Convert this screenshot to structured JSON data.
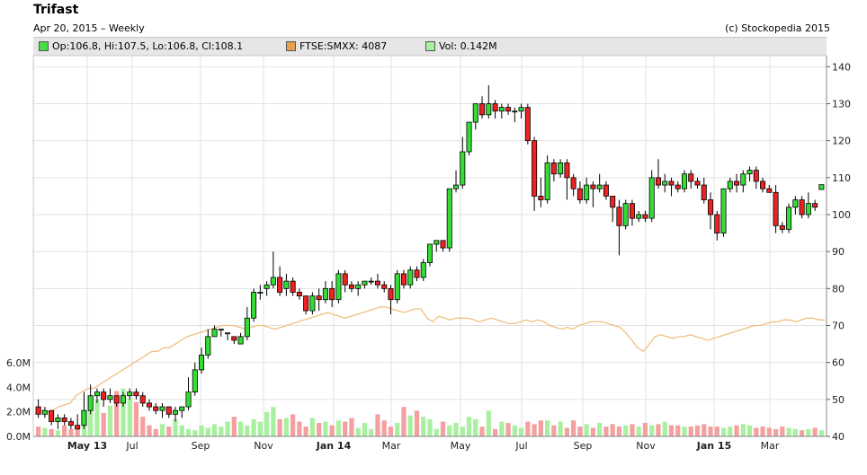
{
  "header": {
    "title": "Trifast",
    "subtitle": "Apr 20, 2015 – Weekly",
    "credit": "(c) Stockopedia 2015"
  },
  "legend": [
    {
      "label": "Op:106.8, Hi:107.5, Lo:106.8, Cl:108.1",
      "color": "#44dd44"
    },
    {
      "label": "FTSE:SMXX: 4087",
      "color": "#e8a050"
    },
    {
      "label": "Vol: 0.142M",
      "color": "#a8f0a0"
    }
  ],
  "chart_data": {
    "type": "candlestick",
    "x_tick_labels": [
      "May 13",
      "Jul",
      "Sep",
      "Nov",
      "Jan 14",
      "Mar",
      "May",
      "Jul",
      "Sep",
      "Nov",
      "Jan 15",
      "Mar"
    ],
    "bold_tick_labels": [
      "May 13",
      "Jan 14",
      "Jan 15"
    ],
    "price_ticks": [
      40,
      50,
      60,
      70,
      80,
      90,
      100,
      110,
      120,
      130,
      140
    ],
    "volume_ticks": [
      "0.0M",
      "2.0M",
      "4.0M",
      "6.0M"
    ],
    "price_range": [
      40,
      143
    ],
    "grid": true,
    "colors": {
      "up": "#33dd33",
      "down": "#ee2222",
      "vol_up": "#a8f0a0",
      "vol_down": "#f4a0a0",
      "index_line": "#f0c080"
    },
    "series": [
      {
        "name": "Trifast",
        "ohlc": [
          [
            48,
            50,
            45,
            46
          ],
          [
            46,
            48,
            45,
            47
          ],
          [
            47,
            47,
            43,
            44
          ],
          [
            44,
            46,
            42,
            45
          ],
          [
            45,
            46,
            43,
            44
          ],
          [
            44,
            45,
            42,
            43
          ],
          [
            43,
            46,
            42,
            42
          ],
          [
            43,
            52,
            42,
            47
          ],
          [
            47,
            54,
            46,
            51
          ],
          [
            51,
            53,
            49,
            52
          ],
          [
            52,
            53,
            48,
            50
          ],
          [
            50,
            53,
            49,
            51
          ],
          [
            51,
            51,
            48,
            49
          ],
          [
            49,
            52,
            48,
            51
          ],
          [
            51,
            53,
            50,
            52
          ],
          [
            52,
            53,
            50,
            51
          ],
          [
            51,
            52,
            48,
            49
          ],
          [
            49,
            50,
            47,
            48
          ],
          [
            48,
            49,
            46,
            47
          ],
          [
            47,
            49,
            45,
            48
          ],
          [
            48,
            48,
            45,
            46
          ],
          [
            46,
            48,
            44,
            47
          ],
          [
            47,
            48,
            45,
            48
          ],
          [
            48,
            56,
            47,
            52
          ],
          [
            52,
            60,
            51,
            58
          ],
          [
            58,
            64,
            57,
            62
          ],
          [
            62,
            69,
            61,
            67
          ],
          [
            67,
            70,
            67,
            69
          ],
          [
            69,
            69,
            67,
            69
          ],
          [
            68,
            68,
            66,
            68
          ],
          [
            67,
            67,
            65,
            66
          ],
          [
            65,
            68,
            65,
            67
          ],
          [
            67,
            75,
            66,
            72
          ],
          [
            72,
            80,
            71,
            79
          ],
          [
            79,
            81,
            77,
            79
          ],
          [
            80,
            82,
            78,
            81
          ],
          [
            81,
            90,
            80,
            83
          ],
          [
            83,
            86,
            78,
            79
          ],
          [
            80,
            84,
            78,
            82
          ],
          [
            82,
            83,
            78,
            79
          ],
          [
            79,
            80,
            77,
            78
          ],
          [
            78,
            78,
            73,
            74
          ],
          [
            74,
            79,
            73,
            78
          ],
          [
            78,
            80,
            74,
            77
          ],
          [
            77,
            82,
            76,
            80
          ],
          [
            80,
            82,
            75,
            77
          ],
          [
            77,
            85,
            76,
            84
          ],
          [
            84,
            85,
            79,
            81
          ],
          [
            81,
            82,
            79,
            80
          ],
          [
            80,
            82,
            78,
            81
          ],
          [
            81,
            82,
            80,
            82
          ],
          [
            82,
            83,
            81,
            82
          ],
          [
            82,
            84,
            80,
            81
          ],
          [
            81,
            82,
            79,
            80
          ],
          [
            80,
            81,
            73,
            77
          ],
          [
            77,
            85,
            76,
            84
          ],
          [
            84,
            85,
            80,
            81
          ],
          [
            81,
            86,
            80,
            85
          ],
          [
            85,
            86,
            82,
            83
          ],
          [
            83,
            88,
            82,
            87
          ],
          [
            87,
            91,
            86,
            92
          ],
          [
            92,
            93,
            90,
            93
          ],
          [
            93,
            93,
            90,
            91
          ],
          [
            91,
            101,
            90,
            107
          ],
          [
            107,
            112,
            106,
            108
          ],
          [
            108,
            121,
            107,
            117
          ],
          [
            117,
            122,
            116,
            125
          ],
          [
            125,
            130,
            123,
            130
          ],
          [
            130,
            132,
            126,
            127
          ],
          [
            127,
            135,
            126,
            130
          ],
          [
            130,
            131,
            126,
            128
          ],
          [
            128,
            130,
            126,
            129
          ],
          [
            129,
            130,
            127,
            128
          ],
          [
            128,
            129,
            125,
            128
          ],
          [
            128,
            130,
            126,
            129
          ],
          [
            129,
            130,
            119,
            120
          ],
          [
            120,
            121,
            101,
            105
          ],
          [
            105,
            110,
            102,
            104
          ],
          [
            104,
            116,
            103,
            114
          ],
          [
            114,
            115,
            109,
            111
          ],
          [
            111,
            115,
            110,
            114
          ],
          [
            114,
            115,
            104,
            110
          ],
          [
            110,
            111,
            105,
            107
          ],
          [
            107,
            109,
            103,
            104
          ],
          [
            104,
            110,
            103,
            108
          ],
          [
            108,
            109,
            102,
            107
          ],
          [
            107,
            111,
            106,
            108
          ],
          [
            108,
            109,
            104,
            105
          ],
          [
            105,
            105,
            98,
            102
          ],
          [
            102,
            104,
            89,
            97
          ],
          [
            97,
            104,
            96,
            103
          ],
          [
            103,
            104,
            97,
            99
          ],
          [
            99,
            101,
            98,
            100
          ],
          [
            100,
            101,
            98,
            99
          ],
          [
            99,
            112,
            98,
            110
          ],
          [
            110,
            115,
            107,
            108
          ],
          [
            108,
            111,
            106,
            109
          ],
          [
            109,
            110,
            105,
            108
          ],
          [
            108,
            109,
            106,
            107
          ],
          [
            107,
            112,
            106,
            111
          ],
          [
            111,
            112,
            107,
            109
          ],
          [
            109,
            110,
            107,
            108
          ],
          [
            108,
            110,
            103,
            104
          ],
          [
            104,
            106,
            96,
            100
          ],
          [
            100,
            101,
            93,
            95
          ],
          [
            95,
            107,
            94,
            107
          ],
          [
            107,
            110,
            106,
            109
          ],
          [
            109,
            111,
            106,
            108
          ],
          [
            108,
            112,
            106,
            111
          ],
          [
            111,
            113,
            109,
            112
          ],
          [
            112,
            113,
            107,
            109
          ],
          [
            109,
            110,
            106,
            107
          ],
          [
            107,
            108,
            106,
            106
          ],
          [
            106,
            108,
            95,
            97
          ],
          [
            97,
            98,
            95,
            96
          ],
          [
            96,
            103,
            95,
            102
          ],
          [
            102,
            105,
            100,
            104
          ],
          [
            104,
            105,
            99,
            100
          ],
          [
            100,
            106,
            99,
            103
          ],
          [
            103,
            104,
            101,
            102
          ],
          [
            106.8,
            107.5,
            106.8,
            108.1
          ]
        ]
      },
      {
        "name": "FTSE:SMXX",
        "values": [
          46,
          47,
          46.5,
          47,
          48,
          48.5,
          49,
          51,
          52,
          53,
          53,
          54,
          55,
          56,
          57,
          58,
          59,
          60,
          61,
          62,
          63,
          63,
          64,
          64,
          65,
          66,
          67,
          67.5,
          68,
          68.5,
          69,
          69.5,
          70,
          70,
          70,
          69.5,
          69,
          69.5,
          70,
          70,
          69.5,
          69,
          69.5,
          70,
          70.5,
          71,
          71.5,
          72,
          72.5,
          73,
          73.5,
          73,
          72.5,
          72,
          72.5,
          73,
          73.5,
          74,
          74.5,
          75,
          75,
          74.5,
          74,
          73.5,
          74,
          74.5,
          74.5,
          72,
          71,
          72.5,
          72,
          71.5,
          72,
          72,
          72,
          71.5,
          71,
          71.5,
          72,
          71.5,
          71,
          70.5,
          70.5,
          71,
          71.5,
          71,
          71.5,
          71,
          70,
          69.5,
          69,
          69.5,
          69,
          70,
          70.5,
          71,
          71,
          71,
          70.5,
          70,
          69.5,
          68,
          66,
          64,
          63,
          65,
          67,
          67.5,
          67,
          66.5,
          67,
          67,
          67.5,
          67,
          66.5,
          66,
          66.5,
          67,
          67.5,
          68,
          68.5,
          69,
          69.5,
          70,
          70,
          70.5,
          71,
          71,
          71.5,
          71.5,
          71,
          71.5,
          72,
          72,
          71.5,
          71.5
        ]
      },
      {
        "name": "Vol",
        "values": [
          0.8,
          0.7,
          0.6,
          0.5,
          0.9,
          0.6,
          0.7,
          1.1,
          2.2,
          3.0,
          1.9,
          2.5,
          3.7,
          3.9,
          3.1,
          2.8,
          1.6,
          0.9,
          0.6,
          1.0,
          0.8,
          1.4,
          0.9,
          0.6,
          0.5,
          0.9,
          0.7,
          1.0,
          0.8,
          1.2,
          1.6,
          1.2,
          0.9,
          1.4,
          1.2,
          2.0,
          2.4,
          1.4,
          1.5,
          1.8,
          1.2,
          0.8,
          1.5,
          1.1,
          1.2,
          0.9,
          1.3,
          1.2,
          1.5,
          0.7,
          1.1,
          0.6,
          1.8,
          1.3,
          0.8,
          1.1,
          2.4,
          1.7,
          2.1,
          1.6,
          1.4,
          0.6,
          1.2,
          0.9,
          1.1,
          0.8,
          1.6,
          1.4,
          0.8,
          2.1,
          0.6,
          1.2,
          1.1,
          0.9,
          0.7,
          1.2,
          1.0,
          1.3,
          1.3,
          0.9,
          1.2,
          0.7,
          1.3,
          0.8,
          1.0,
          0.7,
          1.1,
          0.8,
          1.0,
          0.8,
          0.9,
          1.0,
          0.8,
          1.1,
          0.9,
          1.0,
          1.2,
          0.9,
          0.9,
          0.8,
          0.8,
          0.9,
          1.0,
          0.8,
          0.8,
          0.7,
          0.8,
          0.9,
          1.0,
          0.9,
          0.7,
          0.8,
          0.7,
          0.6,
          0.8,
          0.7,
          0.6,
          0.5,
          0.6,
          0.7,
          0.5,
          0.6,
          0.5,
          0.6,
          0.5,
          0.6,
          0.5,
          0.6,
          0.5,
          0.6,
          0.5,
          0.6,
          0.5,
          0.6
        ]
      }
    ]
  }
}
